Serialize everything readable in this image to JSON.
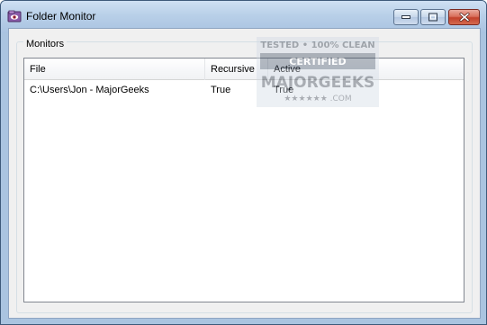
{
  "window": {
    "title": "Folder Monitor",
    "icons": {
      "app": "folder-monitor-app-icon",
      "minimize": "minimize-icon",
      "maximize": "maximize-icon",
      "close": "close-icon"
    }
  },
  "groupbox": {
    "label": "Monitors"
  },
  "listview": {
    "columns": [
      "File",
      "Recursive",
      "Active"
    ],
    "rows": [
      {
        "file": "C:\\Users\\Jon - MajorGeeks",
        "recursive": "True",
        "active": "True"
      }
    ]
  },
  "watermark": {
    "line1": "TESTED • 100% CLEAN",
    "line2": "CERTIFIED",
    "line3": "MAJORGEEKS",
    "line4": "★★★★★★ .COM"
  },
  "colors": {
    "titlebar": "#b8cfe8",
    "close_button": "#c2412b",
    "client_bg": "#f0f0f0",
    "list_bg": "#ffffff"
  }
}
